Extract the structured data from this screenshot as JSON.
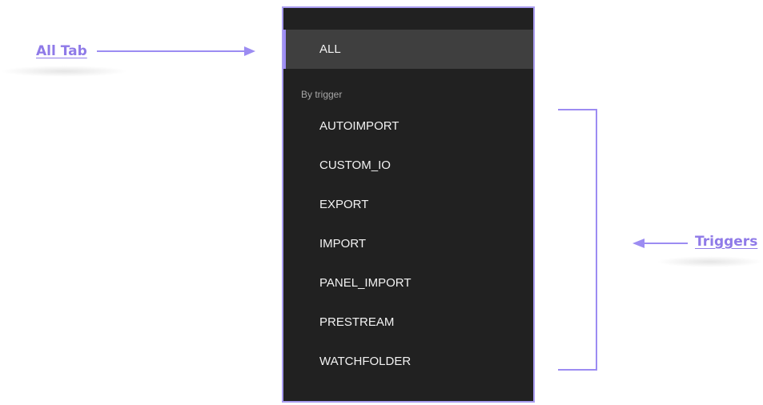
{
  "annotations": {
    "all_tab_label": "All Tab",
    "triggers_label": "Triggers",
    "accent_color": "#8f7ae8"
  },
  "panel": {
    "all_item": {
      "label": "ALL",
      "active": true
    },
    "section_header": "By trigger",
    "trigger_items": [
      {
        "label": "AUTOIMPORT"
      },
      {
        "label": "CUSTOM_IO"
      },
      {
        "label": "EXPORT"
      },
      {
        "label": "IMPORT"
      },
      {
        "label": "PANEL_IMPORT"
      },
      {
        "label": "PRESTREAM"
      },
      {
        "label": "WATCHFOLDER"
      }
    ],
    "background_color": "#212121",
    "active_background_color": "#3f3f3f",
    "active_indicator_color": "#9d8cf5"
  }
}
